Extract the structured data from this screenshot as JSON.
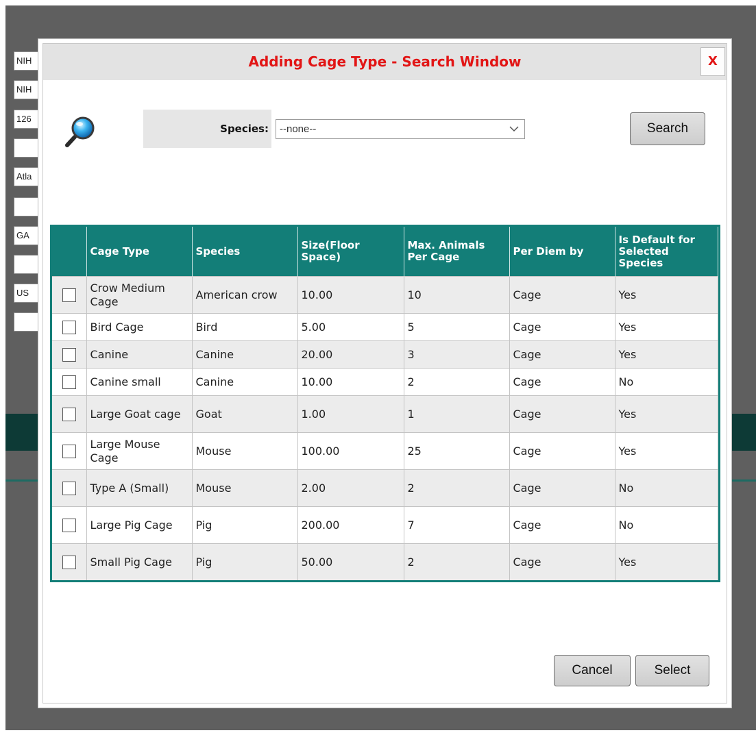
{
  "background": {
    "fields": [
      "NIH",
      "NIH",
      "126",
      "",
      "Atla",
      "",
      "GA",
      "",
      "US",
      ""
    ]
  },
  "dialog": {
    "title": "Adding Cage Type - Search Window",
    "close_label": "X"
  },
  "search": {
    "species_label": "Species:",
    "species_value": "--none--",
    "search_label": "Search"
  },
  "grid": {
    "headers": {
      "cage_type": "Cage Type",
      "species": "Species",
      "size": "Size(Floor Space)",
      "max_animals": "Max. Animals Per Cage",
      "per_diem": "Per Diem by",
      "is_default": "Is Default for Selected Species"
    },
    "rows": [
      {
        "cage_type": "Crow Medium Cage",
        "species": "American crow",
        "size": "10.00",
        "max_animals": "10",
        "per_diem": "Cage",
        "is_default": "Yes"
      },
      {
        "cage_type": "Bird Cage",
        "species": "Bird",
        "size": "5.00",
        "max_animals": "5",
        "per_diem": "Cage",
        "is_default": "Yes"
      },
      {
        "cage_type": "Canine",
        "species": "Canine",
        "size": "20.00",
        "max_animals": "3",
        "per_diem": "Cage",
        "is_default": "Yes"
      },
      {
        "cage_type": "Canine small",
        "species": "Canine",
        "size": "10.00",
        "max_animals": "2",
        "per_diem": "Cage",
        "is_default": "No"
      },
      {
        "cage_type": "Large Goat cage",
        "species": "Goat",
        "size": "1.00",
        "max_animals": "1",
        "per_diem": "Cage",
        "is_default": "Yes"
      },
      {
        "cage_type": "Large Mouse Cage",
        "species": "Mouse",
        "size": "100.00",
        "max_animals": "25",
        "per_diem": "Cage",
        "is_default": "Yes"
      },
      {
        "cage_type": "Type A (Small)",
        "species": "Mouse",
        "size": "2.00",
        "max_animals": "2",
        "per_diem": "Cage",
        "is_default": "No"
      },
      {
        "cage_type": "Large Pig Cage",
        "species": "Pig",
        "size": "200.00",
        "max_animals": "7",
        "per_diem": "Cage",
        "is_default": "No"
      },
      {
        "cage_type": "Small Pig Cage",
        "species": "Pig",
        "size": "50.00",
        "max_animals": "2",
        "per_diem": "Cage",
        "is_default": "Yes"
      }
    ]
  },
  "footer": {
    "cancel_label": "Cancel",
    "select_label": "Select"
  },
  "colors": {
    "title": "#e21515",
    "grid_header": "#137e78",
    "overlay": "#5f5f5f"
  }
}
